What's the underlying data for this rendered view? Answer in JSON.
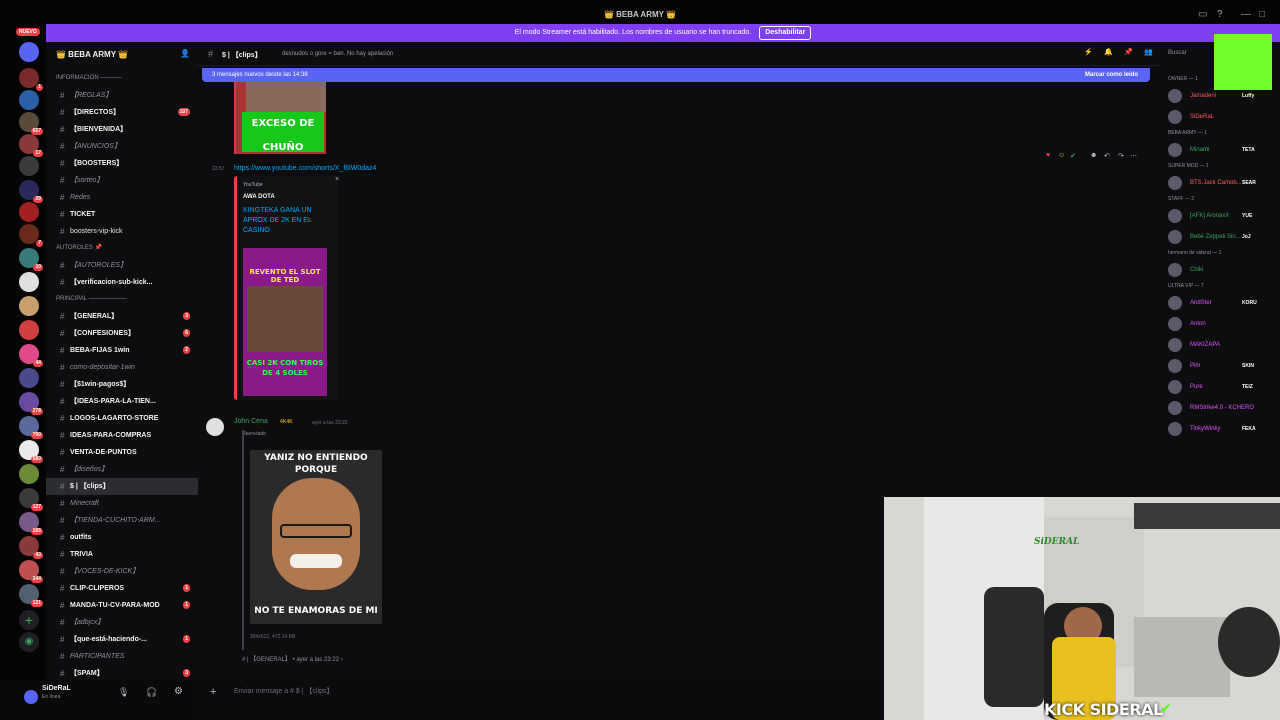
{
  "window": {
    "title": "👑 BEBA ARMY 👑",
    "streamer_banner": "El modo Streamer está habilitado. Los nombres de usuario se han truncado.",
    "streamer_button": "Deshabilitar",
    "new_badge": "NUEVO"
  },
  "server": {
    "name": "👑 BEBA ARMY 👑"
  },
  "guild_badges": [
    "1",
    "657",
    "17",
    "29",
    "7",
    "10",
    "44",
    "278",
    "790",
    "580",
    "127",
    "165",
    "43",
    "344",
    "121"
  ],
  "channels": [
    {
      "name": "INFORMACION ─────",
      "type": "category"
    },
    {
      "name": "【REGLAS】",
      "style": "dim"
    },
    {
      "name": "【DIRECTOS】",
      "style": "bold",
      "badge": "107"
    },
    {
      "name": "【BIENVENIDA】",
      "style": "bold"
    },
    {
      "name": "【ANUNCIOS】",
      "style": "dim"
    },
    {
      "name": "【BOOSTERS】",
      "style": "bold"
    },
    {
      "name": "【sorteo】",
      "style": "dim"
    },
    {
      "name": "Redes",
      "style": "dim"
    },
    {
      "name": "TICKET",
      "style": "bold"
    },
    {
      "name": "boosters-vip-kick",
      "style": "normal"
    },
    {
      "name": "AUTOROLES 📌",
      "type": "category"
    },
    {
      "name": "【AUTOROLES】",
      "style": "dim"
    },
    {
      "name": "【verificacion-sub-kick...",
      "style": "bold"
    },
    {
      "name": "PRINCIPAL ─────────",
      "type": "category"
    },
    {
      "name": "【GENERAL】",
      "style": "bold",
      "badge": "3"
    },
    {
      "name": "【CONFESIONES】",
      "style": "bold",
      "badge": "6"
    },
    {
      "name": "BEBA-FIJAS 1win",
      "style": "bold",
      "badge": "2"
    },
    {
      "name": "como-depositar-1win",
      "style": "dim"
    },
    {
      "name": "【$1win-pagos$】",
      "style": "bold"
    },
    {
      "name": "【IDEAS-PARA-LA-TIEN...",
      "style": "bold"
    },
    {
      "name": "LOGOS-LAGARTO-STORE",
      "style": "bold"
    },
    {
      "name": "IDEAS-PARA-COMPRAS",
      "style": "bold"
    },
    {
      "name": "VENTA-DE-PUNTOS",
      "style": "bold"
    },
    {
      "name": "【diseños】",
      "style": "dim"
    },
    {
      "name": "$ | 【clips】",
      "style": "selected"
    },
    {
      "name": "Minecraft",
      "style": "dim"
    },
    {
      "name": "【TIENDA-CUCHITO-ARM...",
      "style": "dim"
    },
    {
      "name": "outfits",
      "style": "bold"
    },
    {
      "name": "TRIVIA",
      "style": "bold"
    },
    {
      "name": "【VOCES-DE-KICK】",
      "style": "dim"
    },
    {
      "name": "CLIP-CLIPEROS",
      "style": "bold",
      "badge": "1"
    },
    {
      "name": "MANDA-TU-CV-PARA-MOD",
      "style": "bold",
      "badge": "1"
    },
    {
      "name": "【adbjcx】",
      "style": "dim"
    },
    {
      "name": "【que-está-haciendo-...",
      "style": "bold",
      "badge": "1"
    },
    {
      "name": "PARTICIPANTES",
      "style": "dim"
    },
    {
      "name": "【SPAM】",
      "style": "bold",
      "badge": "3"
    }
  ],
  "user": {
    "name": "SiDeRaL",
    "status": "En línea"
  },
  "header": {
    "channel": "$ | 【clips】",
    "topic": "desnudos o gore = ban. No hay apelación",
    "search_placeholder": "Buscar"
  },
  "new_messages": {
    "text": "3 mensajes nuevos desde las 14:38",
    "mark_read": "Marcar como leído"
  },
  "messages": {
    "meme1_caption": "EXCESO DE CHUÑO",
    "link_time": "22:57",
    "link": "https://www.youtube.com/shorts/X_f6lW0daz4",
    "embed_provider": "YouTube",
    "embed_author": "AWA DOTA",
    "embed_title": "KINGTEKA GANA UN APROX DE 2K EN EL CASINO",
    "thumb_top": "REVENTO EL SLOT DE TED",
    "thumb_bottom": "CASI 2K CON TIROS DE 4 SOLES",
    "msg2_author": "John Cena",
    "msg2_tag": "4K4K",
    "msg2_time": "ayer a las 23:22",
    "msg2_forwarded": "Reenviado",
    "meme2_top": "YANIZ NO ENTIENDO PORQUE",
    "meme2_bottom": "NO TE ENAMORAS DE MI",
    "meme2_meta": "394x512, 472.14 KB",
    "msg2_source": "# | 【GENERAL】 • ayer a las 23:22 ›"
  },
  "input": {
    "placeholder": "Enviar mensaje a # $ | 【clips】"
  },
  "members": [
    {
      "cat": "OWNER — 1"
    },
    {
      "name": "Jamadeni",
      "color": "#ff5c5c",
      "tag": "Luffy"
    },
    {
      "name": "SiDeRaL",
      "color": "#ff5c5c"
    },
    {
      "cat": "BEBA ARMY — 1"
    },
    {
      "name": "Minami",
      "color": "#3ba55d",
      "tag": "TETA"
    },
    {
      "cat": "SUPER MOD — 1"
    },
    {
      "name": "BTS.Jack Camob...",
      "color": "#ff5c5c",
      "tag": "SEAR"
    },
    {
      "cat": "STAFF — 2"
    },
    {
      "name": "[AFK] AronaxX",
      "color": "#3ba55d",
      "tag": "YUE"
    },
    {
      "name": "Bebé Zeppeli Sin...",
      "color": "#3ba55d",
      "tag": "JoJ"
    },
    {
      "cat": "hermano de sideral — 1"
    },
    {
      "name": "Chiki",
      "color": "#3ba55d"
    },
    {
      "cat": "ULTRA VIP — 7"
    },
    {
      "name": "AndSter",
      "color": "#e056fd",
      "tag": "KORU"
    },
    {
      "name": "Anton",
      "color": "#e056fd"
    },
    {
      "name": "MAKIZAPA",
      "color": "#e056fd"
    },
    {
      "name": "Pim",
      "color": "#e056fd",
      "tag": "SKIN"
    },
    {
      "name": "Pure",
      "color": "#e056fd",
      "tag": "TEIZ"
    },
    {
      "name": "RMStrike4.0 - KCHERO",
      "color": "#e056fd"
    },
    {
      "name": "TinkyWinky",
      "color": "#e056fd",
      "tag": "FEKA"
    }
  ],
  "webcam": {
    "overlay_text": "KICK SIDERAL",
    "poster_text": "SiDERAL"
  }
}
